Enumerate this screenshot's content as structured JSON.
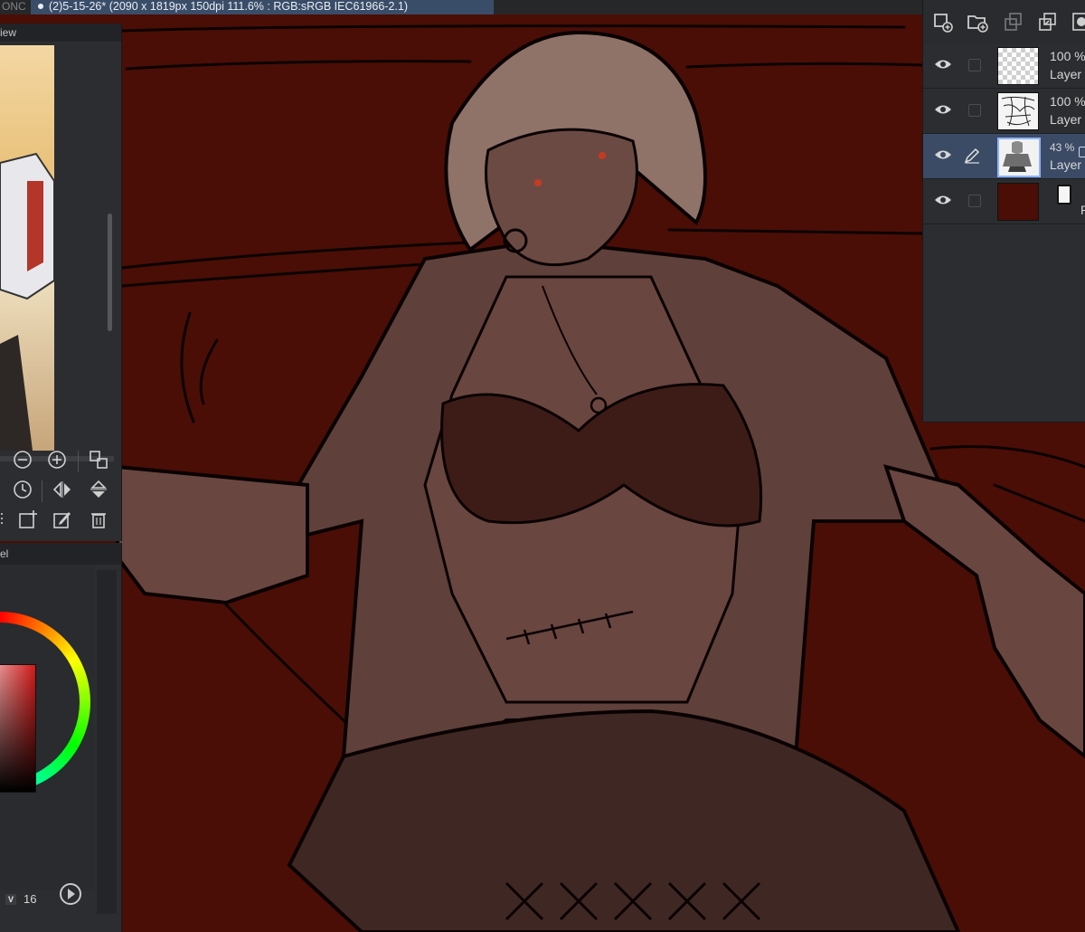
{
  "tabs": {
    "inactive_label": "ONC",
    "active_label": "(2)5-15-26* (2090 x 1819px 150dpi 111.6% : RGB:sRGB IEC61966-2.1)"
  },
  "navigator": {
    "header": "iew",
    "tools_row1": [
      "zoom-out",
      "zoom-in",
      "fit"
    ],
    "tools_row2": [
      "rotate",
      "flip-horizontal",
      "flip-vertical"
    ],
    "tools_row3": [
      "add-view",
      "edit-view",
      "delete-view"
    ]
  },
  "color_panel": {
    "header": "el",
    "brush_size_mode": "V",
    "brush_size_value": "16",
    "main_color": "#d11b1b"
  },
  "layers": [
    {
      "opacity": "100 %",
      "name": "Layer",
      "visible": true,
      "thumb": "transparent"
    },
    {
      "opacity": "100 %",
      "name": "Layer",
      "visible": true,
      "thumb": "lineart"
    },
    {
      "opacity": "43 %",
      "name": "Layer",
      "visible": true,
      "thumb": "sketch",
      "selected": true,
      "editing": true
    },
    {
      "opacity": "",
      "name": "P",
      "visible": true,
      "thumb": "paper"
    }
  ],
  "colors": {
    "canvas_background": "#4a0e06",
    "skin_tone": "#5e3b35",
    "active_tab": "#3a4d68",
    "selected_layer": "#3b4b66"
  }
}
